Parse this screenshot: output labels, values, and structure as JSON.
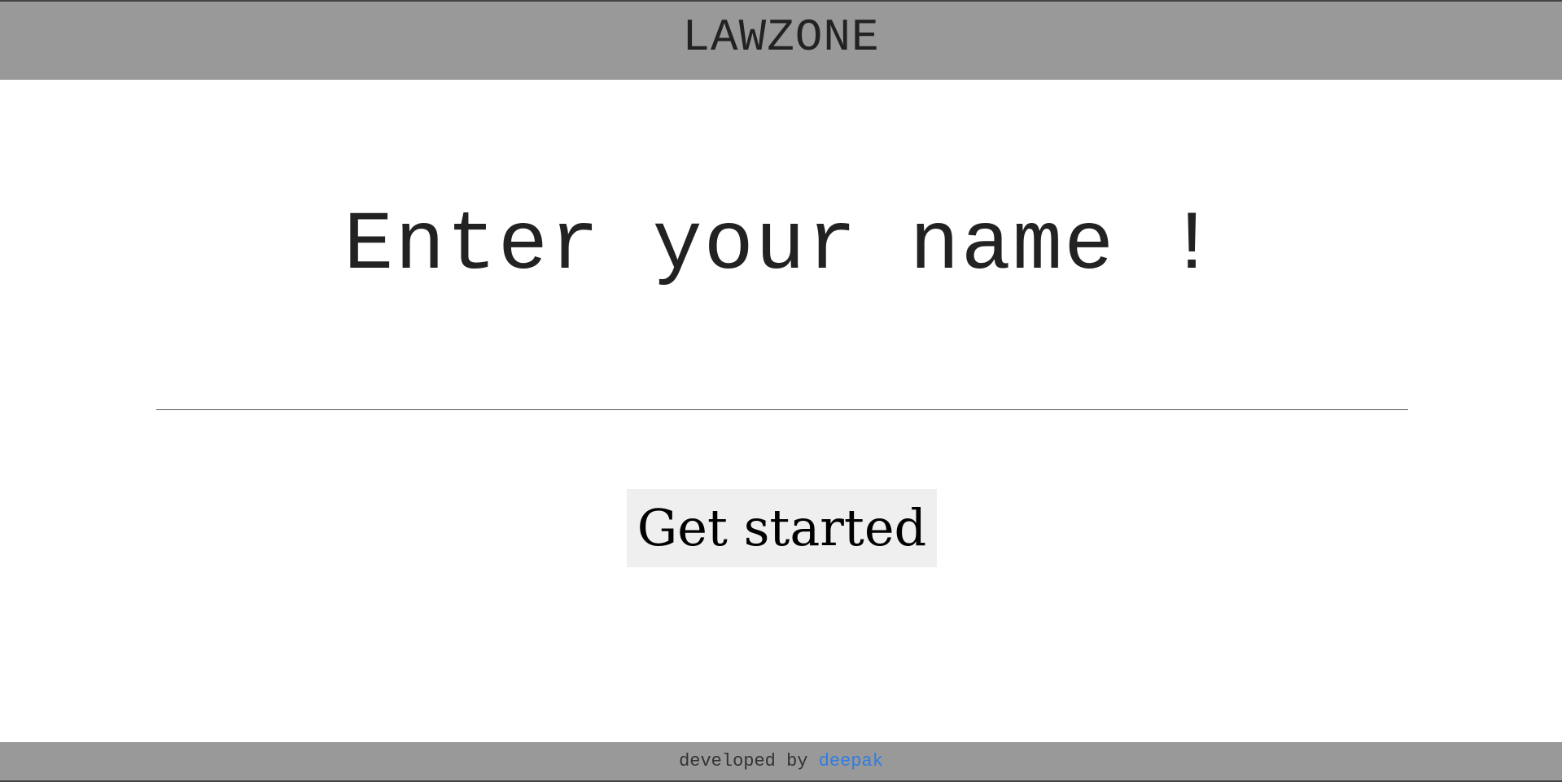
{
  "header": {
    "brand": "LAWZONE"
  },
  "main": {
    "prompt": "Enter your name !",
    "name_input": {
      "value": "",
      "placeholder": ""
    },
    "start_button_label": "Get started"
  },
  "footer": {
    "prefix": "developed by",
    "author_link": "deepak"
  },
  "colors": {
    "header_bg": "#999999",
    "footer_bg": "#999999",
    "button_bg": "#efefef",
    "link": "#2f7de1",
    "text": "#222222"
  }
}
